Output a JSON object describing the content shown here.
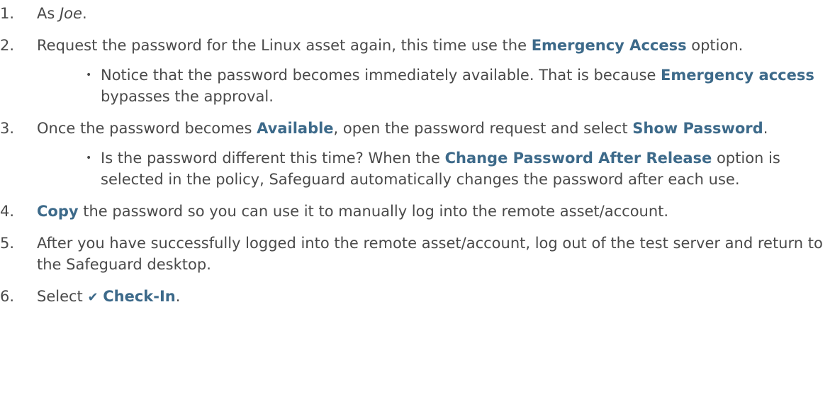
{
  "steps": [
    {
      "number": "1.",
      "parts": [
        "As ",
        "Joe",
        "."
      ]
    },
    {
      "number": "2.",
      "parts": [
        "Request the password for the Linux asset again, this time use the ",
        "Emergency Access",
        " option."
      ],
      "note": {
        "parts": [
          "Notice that the password becomes immediately available. That is because ",
          "Emergency access",
          " bypasses the approval."
        ]
      }
    },
    {
      "number": "3.",
      "parts": [
        "Once the password becomes ",
        "Available",
        ", open the password request and select ",
        "Show Password",
        "."
      ],
      "note": {
        "parts": [
          "Is the password different this time? When the ",
          "Change Password After Release",
          " option is selected in the policy, Safeguard automatically changes the password after each use."
        ]
      }
    },
    {
      "number": "4.",
      "parts": [
        "Copy",
        " the password so you can use it to manually log into the remote asset/account."
      ]
    },
    {
      "number": "5.",
      "parts": [
        "After you have successfully logged into the remote asset/account, log out of the test server and return to the Safeguard desktop."
      ]
    },
    {
      "number": "6.",
      "parts": [
        "Select ",
        "Check-In",
        "."
      ]
    }
  ],
  "icons": {
    "bullet": "•",
    "check": "✔"
  },
  "colors": {
    "text": "#4a4a4a",
    "emphasis": "#3d6a8a"
  }
}
